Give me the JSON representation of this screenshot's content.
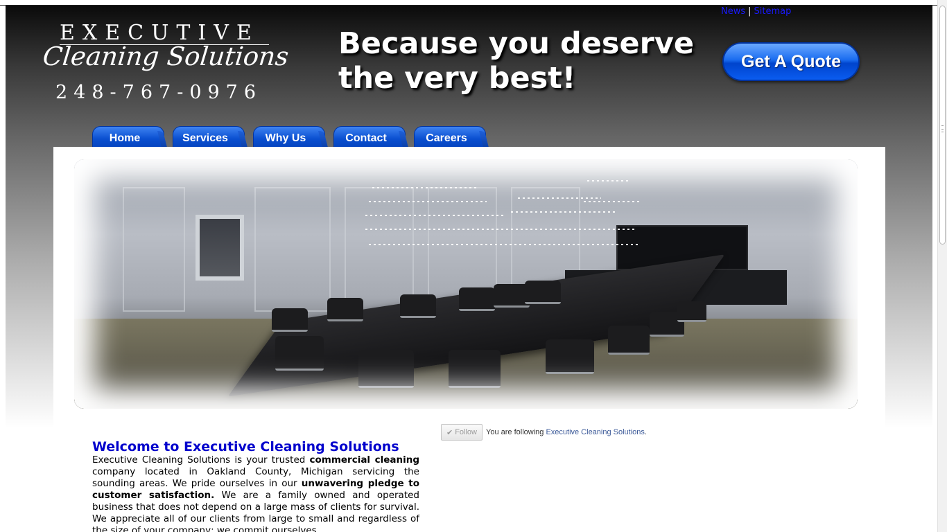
{
  "top_links": {
    "news": "News",
    "separator": "|",
    "sitemap": "Sitemap"
  },
  "logo": {
    "top": "EXECUTIVE",
    "script": "Cleaning Solutions",
    "phone": "248-767-0976"
  },
  "tagline": "Because you deserve the very best!",
  "quote_button": "Get A Quote",
  "nav": {
    "items": [
      "Home",
      "Services",
      "Why Us",
      "Contact",
      "Careers"
    ]
  },
  "welcome": {
    "title": "Welcome to Executive Cleaning Solutions",
    "p1": "Executive Cleaning Solutions is your trusted ",
    "b1": "commercial cleaning",
    "p2": " company located in Oakland County, Michigan servicing the sounding areas. We pride ourselves in our ",
    "b2": "unwavering pledge to customer satisfaction.",
    "p3": " We are a family owned and operated business that does not depend on a large mass of clients for survival. We appreciate all of our clients from large to small and regardless of the size of your company; we commit ourselves"
  },
  "follow": {
    "check": "✔",
    "button": "Follow",
    "prefix": "You are following ",
    "link": "Executive Cleaning Solutions",
    "suffix": "."
  }
}
